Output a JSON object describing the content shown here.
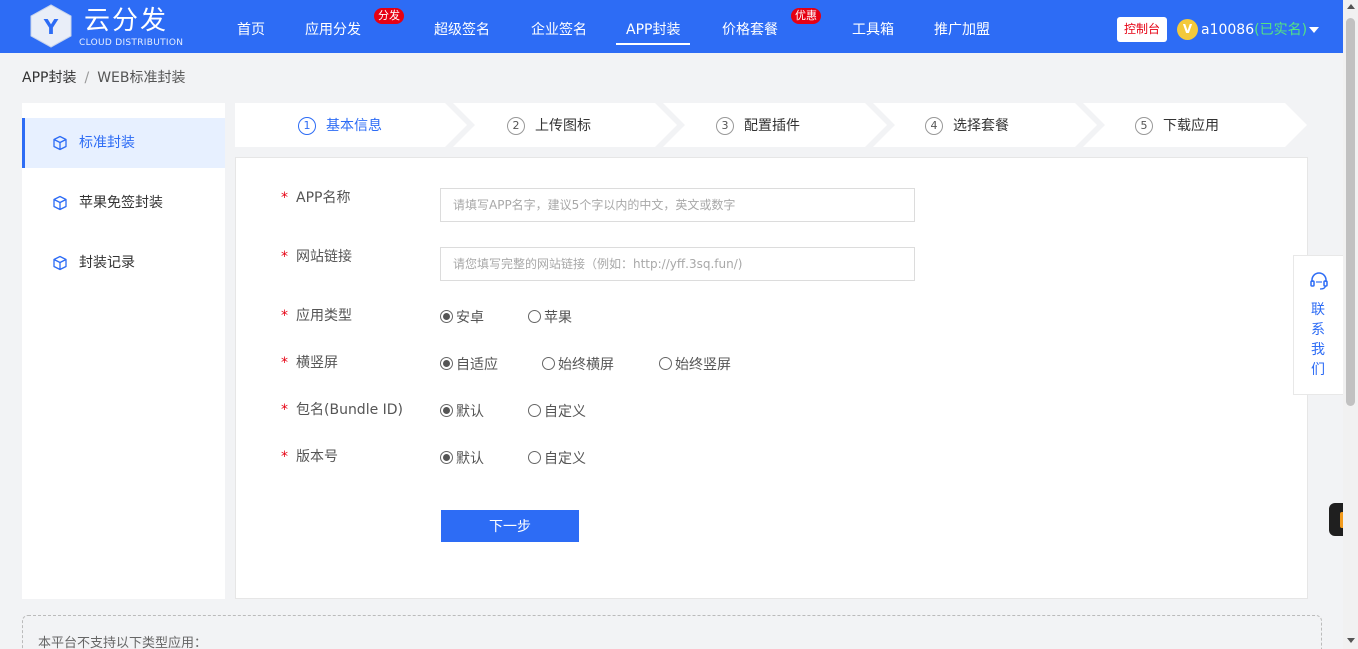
{
  "header": {
    "logo_letter": "Y",
    "logo_title": "云分发",
    "logo_subtitle": "CLOUD DISTRIBUTION",
    "nav": [
      {
        "label": "首页"
      },
      {
        "label": "应用分发",
        "badge": "分发"
      },
      {
        "label": "超级签名"
      },
      {
        "label": "企业签名"
      },
      {
        "label": "APP封装",
        "active": true
      },
      {
        "label": "价格套餐",
        "badge": "优惠"
      },
      {
        "label": "工具箱"
      },
      {
        "label": "推广加盟"
      }
    ],
    "console_label": "控制台",
    "user_badge": "V",
    "user_name": "a10086",
    "user_status": "(已实名)",
    "colors": {
      "brand": "#2d6cf5",
      "badge": "#e60012",
      "verified": "#54e383"
    }
  },
  "breadcrumb": {
    "root": "APP封装",
    "separator": "/",
    "current": "WEB标准封装"
  },
  "sidebar": {
    "items": [
      {
        "label": "标准封装",
        "icon": "cube-icon",
        "active": true
      },
      {
        "label": "苹果免签封装",
        "icon": "cube-icon"
      },
      {
        "label": "封装记录",
        "icon": "cube-icon"
      }
    ]
  },
  "steps": [
    {
      "num": "1",
      "label": "基本信息",
      "active": true
    },
    {
      "num": "2",
      "label": "上传图标"
    },
    {
      "num": "3",
      "label": "配置插件"
    },
    {
      "num": "4",
      "label": "选择套餐"
    },
    {
      "num": "5",
      "label": "下载应用"
    }
  ],
  "form": {
    "required_mark": "*",
    "app_name": {
      "label": "APP名称",
      "placeholder": "请填写APP名字，建议5个字以内的中文，英文或数字",
      "value": ""
    },
    "site_url": {
      "label": "网站链接",
      "placeholder": "请您填写完整的网站链接（例如：http://yff.3sq.fun/)",
      "value": ""
    },
    "app_type": {
      "label": "应用类型",
      "options": [
        "安卓",
        "苹果"
      ],
      "selected": "安卓"
    },
    "orientation": {
      "label": "横竖屏",
      "options": [
        "自适应",
        "始终横屏",
        "始终竖屏"
      ],
      "selected": "自适应"
    },
    "bundle": {
      "label": "包名(Bundle ID)",
      "options": [
        "默认",
        "自定义"
      ],
      "selected": "默认"
    },
    "version": {
      "label": "版本号",
      "options": [
        "默认",
        "自定义"
      ],
      "selected": "默认"
    },
    "next_label": "下一步"
  },
  "notice": {
    "text": "本平台不支持以下类型应用："
  },
  "contact": {
    "label": "联系我们",
    "icon": "headset-icon"
  },
  "tool_float": {
    "icon": "tool-icon"
  }
}
